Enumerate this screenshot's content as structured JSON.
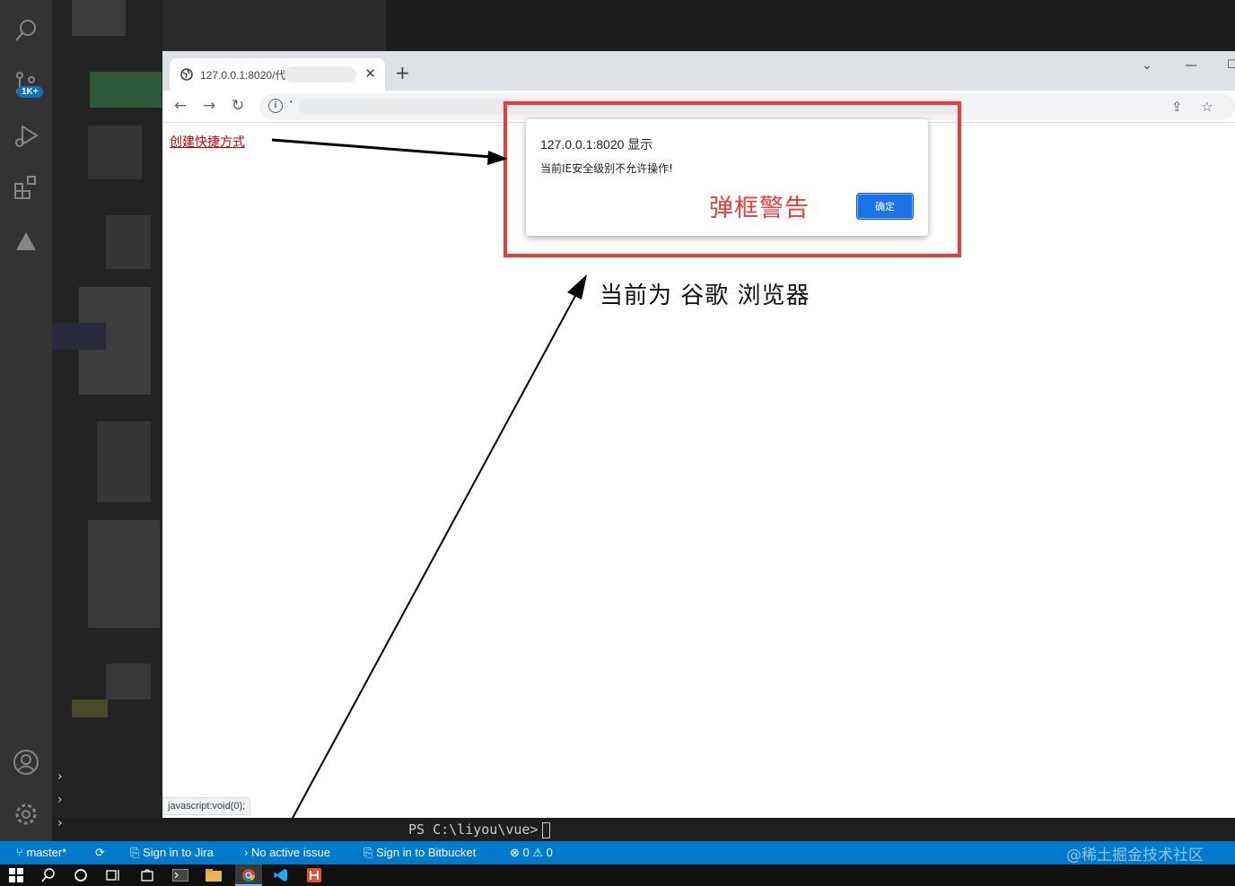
{
  "vscode": {
    "scm_badge": "1K+",
    "terminal_prompt": "PS C:\\liyou\\vue>"
  },
  "browser": {
    "tab_title": "127.0.0.1:8020/代",
    "new_tab_label": "+",
    "omnibox_url": "'",
    "page_link": "创建快捷方式",
    "status_url": "javascript:void(0);"
  },
  "dialog": {
    "title": "127.0.0.1:8020 显示",
    "message": "当前IE安全级别不允许操作!",
    "ok_label": "确定"
  },
  "annotations": {
    "popup_label": "弹框警告",
    "browser_label": "当前为 谷歌 浏览器",
    "red_color": "#f03a3a"
  },
  "statusbar": {
    "branch": "master*",
    "jira": "Sign in to Jira",
    "issue": "No active issue",
    "bitbucket": "Sign in to Bitbucket",
    "errors": "0",
    "warnings": "0",
    "watermark": "@稀土掘金技术社区"
  },
  "colors": {
    "statusbar": "#007acc",
    "activitybar": "#333333",
    "dialog_button": "#1a73e8"
  }
}
